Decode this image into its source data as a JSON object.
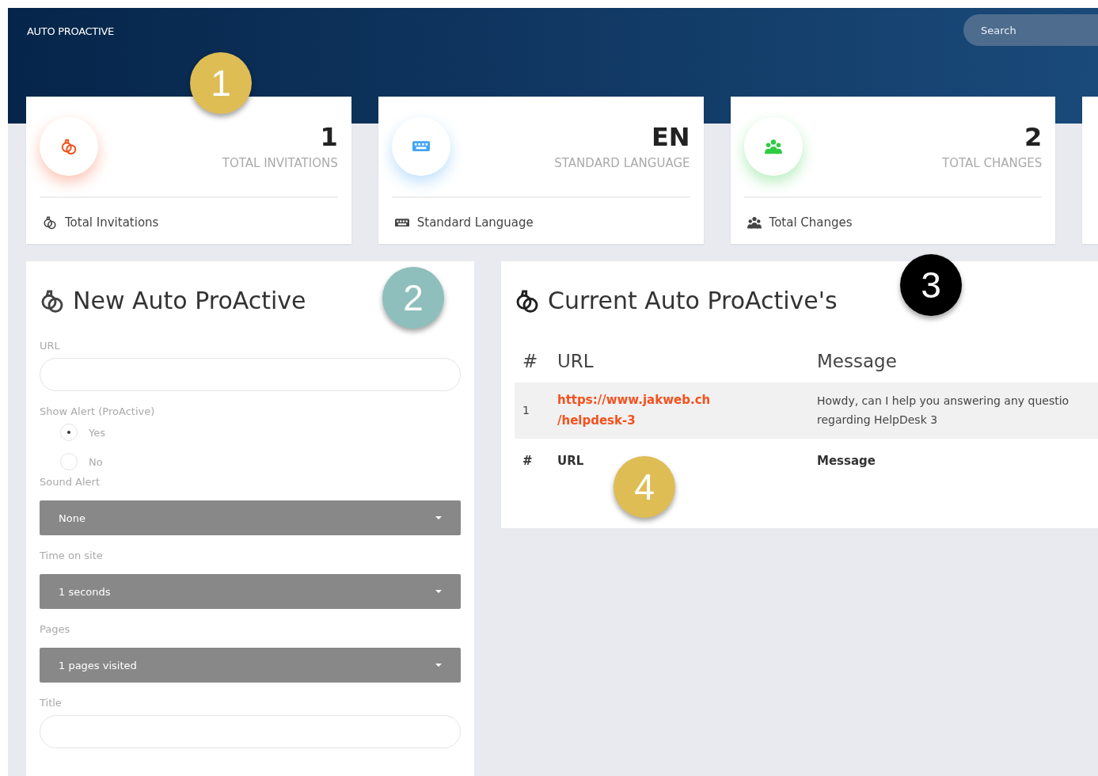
{
  "header": {
    "title": "AUTO PROACTIVE",
    "search": {
      "placeholder": "Search"
    }
  },
  "stats": [
    {
      "value": "1",
      "caption": "TOTAL INVITATIONS",
      "footer": "Total Invitations",
      "color": "#f4511e",
      "kind": "rings"
    },
    {
      "value": "EN",
      "caption": "STANDARD LANGUAGE",
      "footer": "Standard Language",
      "color": "#42a5f5",
      "kind": "keyboard"
    },
    {
      "value": "2",
      "caption": "TOTAL CHANGES",
      "footer": "Total Changes",
      "color": "#2ecc40",
      "kind": "group"
    }
  ],
  "new_panel": {
    "title": "New Auto ProActive",
    "fields": [
      {
        "kind": "text",
        "label": "URL"
      },
      {
        "kind": "radio",
        "label": "Show Alert (ProActive)",
        "options": [
          {
            "label": "Yes",
            "selected": true
          },
          {
            "label": "No",
            "selected": false
          }
        ]
      },
      {
        "kind": "select",
        "label": "Sound Alert",
        "value": "None"
      },
      {
        "kind": "select",
        "label": "Time on site",
        "value": "1 seconds"
      },
      {
        "kind": "select",
        "label": "Pages",
        "value": "1 pages visited"
      },
      {
        "kind": "text",
        "label": "Title"
      }
    ]
  },
  "current_panel": {
    "title": "Current Auto ProActive's",
    "columns": [
      "#",
      "URL",
      "Message"
    ],
    "rows": [
      {
        "number": "1",
        "url_lines": [
          "https://www.jakweb.ch",
          "/helpdesk-3"
        ],
        "message_lines": [
          "Howdy, can I help you answering any questio",
          "regarding HelpDesk 3"
        ]
      }
    ],
    "footer_columns": [
      "#",
      "URL",
      "Message"
    ]
  },
  "callouts": [
    {
      "label": "1",
      "color": "#dfbd55"
    },
    {
      "label": "2",
      "color": "#8fbfbc"
    },
    {
      "label": "3",
      "color": "#000000"
    },
    {
      "label": "4",
      "color": "#dfbd55"
    }
  ]
}
